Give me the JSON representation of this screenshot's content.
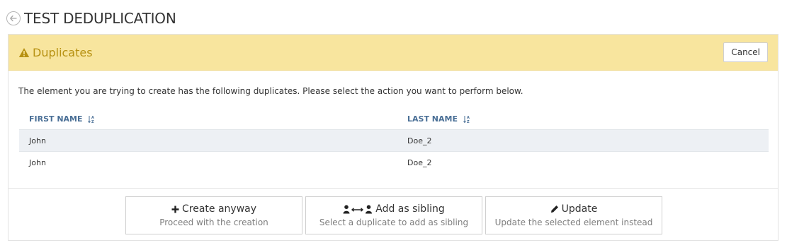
{
  "page": {
    "title": "TEST DEDUPLICATION"
  },
  "panel": {
    "heading": "Duplicates",
    "cancel_label": "Cancel",
    "message": "The element you are trying to create has the following duplicates. Please select the action you want to perform below."
  },
  "table": {
    "columns": [
      "FIRST NAME",
      "LAST NAME"
    ],
    "rows": [
      {
        "first_name": "John",
        "last_name": "Doe_2"
      },
      {
        "first_name": "John",
        "last_name": "Doe_2"
      }
    ]
  },
  "actions": [
    {
      "label": "Create anyway",
      "sub": "Proceed with the creation",
      "icon": "plus-icon"
    },
    {
      "label": "Add as sibling",
      "sub": "Select a duplicate to add as sibling",
      "icon": "user-link-user-icon"
    },
    {
      "label": "Update",
      "sub": "Update the selected element instead",
      "icon": "pencil-icon"
    }
  ],
  "colors": {
    "warning_bg": "#f8e59e",
    "warning_text": "#b79112",
    "header_link": "#4a6f96"
  }
}
